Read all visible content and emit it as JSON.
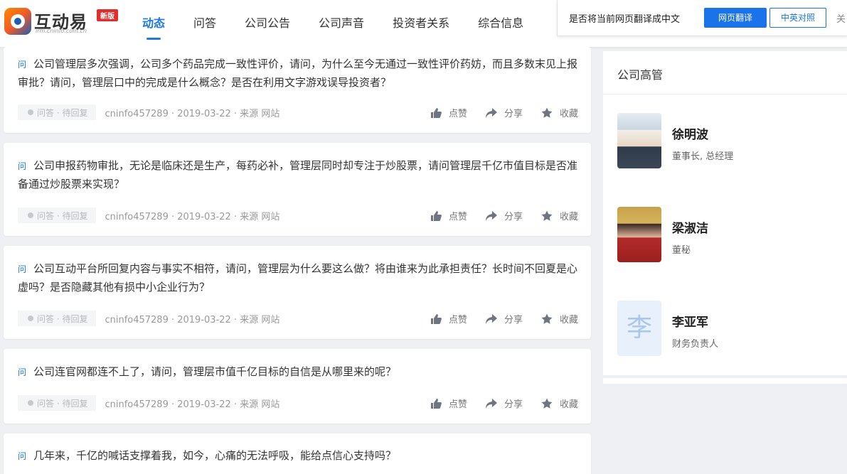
{
  "header": {
    "logo_name": "互动易",
    "logo_badge": "新版",
    "logo_url": "irm.cninfo.com.cn",
    "nav": [
      {
        "label": "动态",
        "active": true
      },
      {
        "label": "问答"
      },
      {
        "label": "公司公告"
      },
      {
        "label": "公司声音"
      },
      {
        "label": "投资者关系"
      },
      {
        "label": "综合信息"
      }
    ]
  },
  "translate": {
    "prompt": "是否将当前网页翻译成中文",
    "translate_label": "网页翻译",
    "bilingual_label": "中英对照",
    "close_label": "关"
  },
  "feed": [
    {
      "q_mark": "问",
      "question": "公司管理层多次强调，公司多个药品完成一致性评价，请问，为什么至今无通过一致性评价药妨，而且多数末见上报审批？请问，管理层口中的完成是什么概念？是否在利用文字游戏误导投资者？",
      "status": "问答 · 待回复",
      "meta": "cninfo457289 · 2019-03-22 · 来源 网站",
      "like": "点赞",
      "share": "分享",
      "fav": "收藏"
    },
    {
      "q_mark": "问",
      "question": "公司申报药物审批，无论是临床还是生产，每药必补，管理层同时却专注于炒股票，请问管理层千亿市值目标是否准备通过炒股票来实现？",
      "status": "问答 · 待回复",
      "meta": "cninfo457289 · 2019-03-22 · 来源 网站",
      "like": "点赞",
      "share": "分享",
      "fav": "收藏"
    },
    {
      "q_mark": "问",
      "question": "公司互动平台所回复内容与事实不相符，请问，管理层为什么要这么做？将由谁来为此承担责任？长时间不回夏是心虚吗？是否隐藏其他有损中小企业行为？",
      "status": "问答 · 待回复",
      "meta": "cninfo457289 · 2019-03-22 · 来源 网站",
      "like": "点赞",
      "share": "分享",
      "fav": "收藏"
    },
    {
      "q_mark": "问",
      "question": "公司连官网都连不上了，请问，管理层市值千亿目标的自信是从哪里来的呢？",
      "status": "问答 · 待回复",
      "meta": "cninfo457289 · 2019-03-22 · 来源 网站",
      "like": "点赞",
      "share": "分享",
      "fav": "收藏"
    },
    {
      "q_mark": "问",
      "question": "几年来，千亿的喊话支撑着我，如今，心痛的无法呼吸，能给点信心支持吗？"
    }
  ],
  "executives": {
    "title": "公司高管",
    "people": [
      {
        "name": "徐明波",
        "role": "董事长, 总经理"
      },
      {
        "name": "梁淑洁",
        "role": "董秘"
      },
      {
        "name": "李亚军",
        "role": "财务负责人",
        "initial": "李"
      }
    ]
  }
}
